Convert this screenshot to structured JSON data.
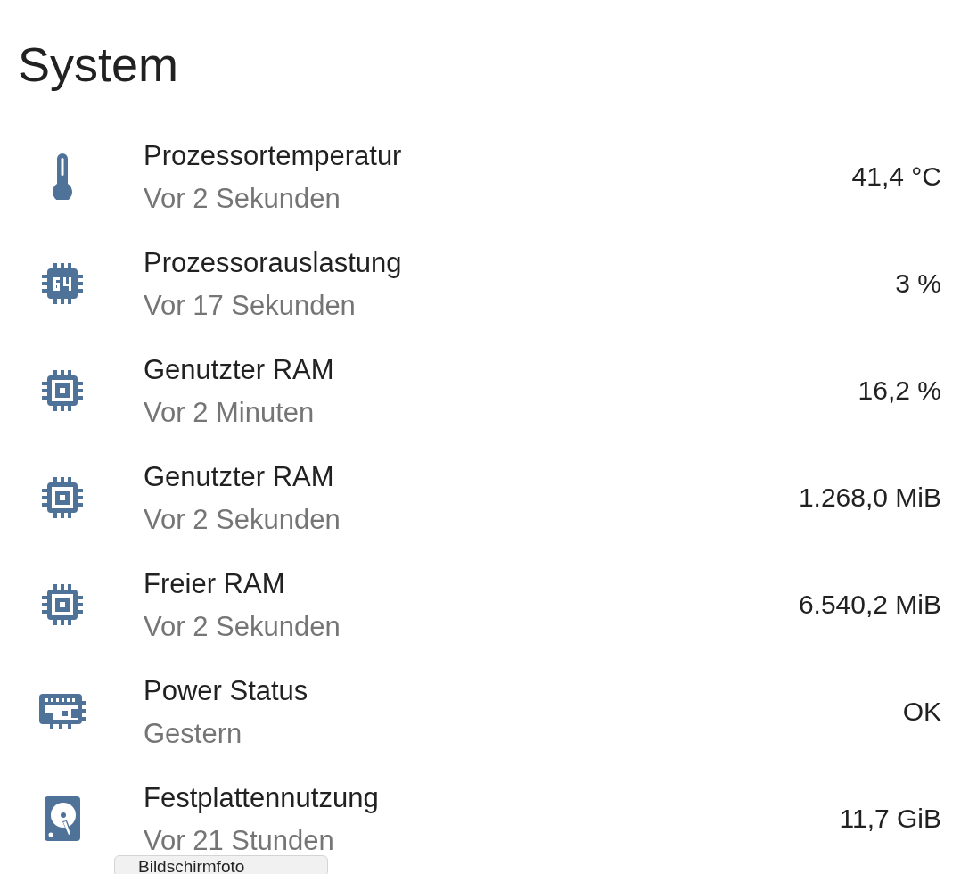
{
  "title": "System",
  "entities": [
    {
      "kind": "thermometer",
      "name": "Prozessortemperatur",
      "updated": "Vor 2 Sekunden",
      "value": "41,4 °C"
    },
    {
      "kind": "cpu64",
      "name": "Prozessorauslastung",
      "updated": "Vor 17 Sekunden",
      "value": "3 %"
    },
    {
      "kind": "chip",
      "name": "Genutzter RAM",
      "updated": "Vor 2 Minuten",
      "value": "16,2 %"
    },
    {
      "kind": "chip",
      "name": "Genutzter RAM",
      "updated": "Vor 2 Sekunden",
      "value": "1.268,0 MiB"
    },
    {
      "kind": "chip",
      "name": "Freier RAM",
      "updated": "Vor 2 Sekunden",
      "value": "6.540,2 MiB"
    },
    {
      "kind": "board",
      "name": "Power Status",
      "updated": "Gestern",
      "value": "OK"
    },
    {
      "kind": "harddisk",
      "name": "Festplattennutzung",
      "updated": "Vor 21 Stunden",
      "value": "11,7 GiB"
    }
  ],
  "tooltip": "Bildschirmfoto"
}
